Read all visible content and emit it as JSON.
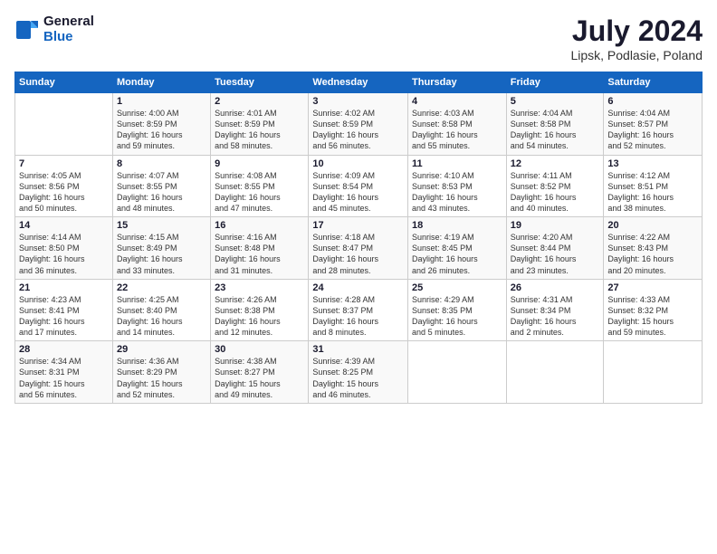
{
  "header": {
    "logo_general": "General",
    "logo_blue": "Blue",
    "title": "July 2024",
    "location": "Lipsk, Podlasie, Poland"
  },
  "columns": [
    "Sunday",
    "Monday",
    "Tuesday",
    "Wednesday",
    "Thursday",
    "Friday",
    "Saturday"
  ],
  "weeks": [
    [
      {
        "day": "",
        "info": ""
      },
      {
        "day": "1",
        "info": "Sunrise: 4:00 AM\nSunset: 8:59 PM\nDaylight: 16 hours\nand 59 minutes."
      },
      {
        "day": "2",
        "info": "Sunrise: 4:01 AM\nSunset: 8:59 PM\nDaylight: 16 hours\nand 58 minutes."
      },
      {
        "day": "3",
        "info": "Sunrise: 4:02 AM\nSunset: 8:59 PM\nDaylight: 16 hours\nand 56 minutes."
      },
      {
        "day": "4",
        "info": "Sunrise: 4:03 AM\nSunset: 8:58 PM\nDaylight: 16 hours\nand 55 minutes."
      },
      {
        "day": "5",
        "info": "Sunrise: 4:04 AM\nSunset: 8:58 PM\nDaylight: 16 hours\nand 54 minutes."
      },
      {
        "day": "6",
        "info": "Sunrise: 4:04 AM\nSunset: 8:57 PM\nDaylight: 16 hours\nand 52 minutes."
      }
    ],
    [
      {
        "day": "7",
        "info": "Sunrise: 4:05 AM\nSunset: 8:56 PM\nDaylight: 16 hours\nand 50 minutes."
      },
      {
        "day": "8",
        "info": "Sunrise: 4:07 AM\nSunset: 8:55 PM\nDaylight: 16 hours\nand 48 minutes."
      },
      {
        "day": "9",
        "info": "Sunrise: 4:08 AM\nSunset: 8:55 PM\nDaylight: 16 hours\nand 47 minutes."
      },
      {
        "day": "10",
        "info": "Sunrise: 4:09 AM\nSunset: 8:54 PM\nDaylight: 16 hours\nand 45 minutes."
      },
      {
        "day": "11",
        "info": "Sunrise: 4:10 AM\nSunset: 8:53 PM\nDaylight: 16 hours\nand 43 minutes."
      },
      {
        "day": "12",
        "info": "Sunrise: 4:11 AM\nSunset: 8:52 PM\nDaylight: 16 hours\nand 40 minutes."
      },
      {
        "day": "13",
        "info": "Sunrise: 4:12 AM\nSunset: 8:51 PM\nDaylight: 16 hours\nand 38 minutes."
      }
    ],
    [
      {
        "day": "14",
        "info": "Sunrise: 4:14 AM\nSunset: 8:50 PM\nDaylight: 16 hours\nand 36 minutes."
      },
      {
        "day": "15",
        "info": "Sunrise: 4:15 AM\nSunset: 8:49 PM\nDaylight: 16 hours\nand 33 minutes."
      },
      {
        "day": "16",
        "info": "Sunrise: 4:16 AM\nSunset: 8:48 PM\nDaylight: 16 hours\nand 31 minutes."
      },
      {
        "day": "17",
        "info": "Sunrise: 4:18 AM\nSunset: 8:47 PM\nDaylight: 16 hours\nand 28 minutes."
      },
      {
        "day": "18",
        "info": "Sunrise: 4:19 AM\nSunset: 8:45 PM\nDaylight: 16 hours\nand 26 minutes."
      },
      {
        "day": "19",
        "info": "Sunrise: 4:20 AM\nSunset: 8:44 PM\nDaylight: 16 hours\nand 23 minutes."
      },
      {
        "day": "20",
        "info": "Sunrise: 4:22 AM\nSunset: 8:43 PM\nDaylight: 16 hours\nand 20 minutes."
      }
    ],
    [
      {
        "day": "21",
        "info": "Sunrise: 4:23 AM\nSunset: 8:41 PM\nDaylight: 16 hours\nand 17 minutes."
      },
      {
        "day": "22",
        "info": "Sunrise: 4:25 AM\nSunset: 8:40 PM\nDaylight: 16 hours\nand 14 minutes."
      },
      {
        "day": "23",
        "info": "Sunrise: 4:26 AM\nSunset: 8:38 PM\nDaylight: 16 hours\nand 12 minutes."
      },
      {
        "day": "24",
        "info": "Sunrise: 4:28 AM\nSunset: 8:37 PM\nDaylight: 16 hours\nand 8 minutes."
      },
      {
        "day": "25",
        "info": "Sunrise: 4:29 AM\nSunset: 8:35 PM\nDaylight: 16 hours\nand 5 minutes."
      },
      {
        "day": "26",
        "info": "Sunrise: 4:31 AM\nSunset: 8:34 PM\nDaylight: 16 hours\nand 2 minutes."
      },
      {
        "day": "27",
        "info": "Sunrise: 4:33 AM\nSunset: 8:32 PM\nDaylight: 15 hours\nand 59 minutes."
      }
    ],
    [
      {
        "day": "28",
        "info": "Sunrise: 4:34 AM\nSunset: 8:31 PM\nDaylight: 15 hours\nand 56 minutes."
      },
      {
        "day": "29",
        "info": "Sunrise: 4:36 AM\nSunset: 8:29 PM\nDaylight: 15 hours\nand 52 minutes."
      },
      {
        "day": "30",
        "info": "Sunrise: 4:38 AM\nSunset: 8:27 PM\nDaylight: 15 hours\nand 49 minutes."
      },
      {
        "day": "31",
        "info": "Sunrise: 4:39 AM\nSunset: 8:25 PM\nDaylight: 15 hours\nand 46 minutes."
      },
      {
        "day": "",
        "info": ""
      },
      {
        "day": "",
        "info": ""
      },
      {
        "day": "",
        "info": ""
      }
    ]
  ]
}
